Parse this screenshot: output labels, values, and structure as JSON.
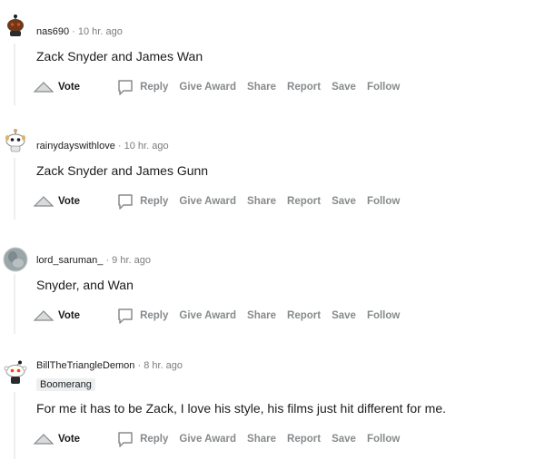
{
  "colors": {
    "text": "#1c1c1c",
    "muted": "#878a8c",
    "line": "#edeff1"
  },
  "comments": [
    {
      "author": "nas690",
      "sep": "·",
      "time": "10 hr. ago",
      "flair": "",
      "text": "Zack Snyder and James Wan",
      "avatar_icon": "snoo-avatar-dark",
      "actions": {
        "vote": "Vote",
        "reply": "Reply",
        "award": "Give Award",
        "share": "Share",
        "report": "Report",
        "save": "Save",
        "follow": "Follow"
      }
    },
    {
      "author": "rainydayswithlove",
      "sep": "·",
      "time": "10 hr. ago",
      "flair": "",
      "text": "Zack Snyder and James Gunn",
      "avatar_icon": "snoo-avatar-light",
      "actions": {
        "vote": "Vote",
        "reply": "Reply",
        "award": "Give Award",
        "share": "Share",
        "report": "Report",
        "save": "Save",
        "follow": "Follow"
      }
    },
    {
      "author": "lord_saruman_",
      "sep": "·",
      "time": "9 hr. ago",
      "flair": "",
      "text": "Snyder, and Wan",
      "avatar_icon": "photo-avatar",
      "actions": {
        "vote": "Vote",
        "reply": "Reply",
        "award": "Give Award",
        "share": "Share",
        "report": "Report",
        "save": "Save",
        "follow": "Follow"
      }
    },
    {
      "author": "BillTheTriangleDemon",
      "sep": "·",
      "time": "8 hr. ago",
      "flair": "Boomerang",
      "text": "For me it has to be Zack, I love his style, his films just hit different for me.",
      "avatar_icon": "snoo-avatar-default",
      "actions": {
        "vote": "Vote",
        "reply": "Reply",
        "award": "Give Award",
        "share": "Share",
        "report": "Report",
        "save": "Save",
        "follow": "Follow"
      }
    }
  ]
}
